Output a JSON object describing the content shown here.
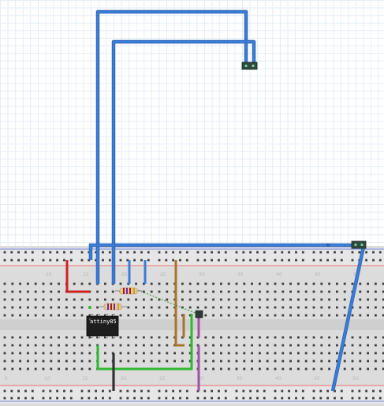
{
  "app": {
    "view": "breadboard"
  },
  "chip": {
    "label": "attiny85"
  },
  "breadboard": {
    "column_labels_top": [
      "10",
      "15",
      "20",
      "25",
      "30",
      "35",
      "40",
      "45",
      "50"
    ],
    "column_labels_bottom": [
      "5",
      "10",
      "15",
      "20",
      "25",
      "30",
      "35",
      "40",
      "45",
      "50"
    ]
  },
  "colors": {
    "wire_blue": "#3a7dd6",
    "wire_red": "#cc2222",
    "wire_green": "#2fb82f",
    "wire_brown": "#a8742a",
    "wire_purple": "#a050a8",
    "wire_black": "#333333",
    "rail_red": "#e04040",
    "rail_blue": "#4a6ad8",
    "chip_body": "#1e1e1e",
    "header_body": "#2e4a3e"
  }
}
